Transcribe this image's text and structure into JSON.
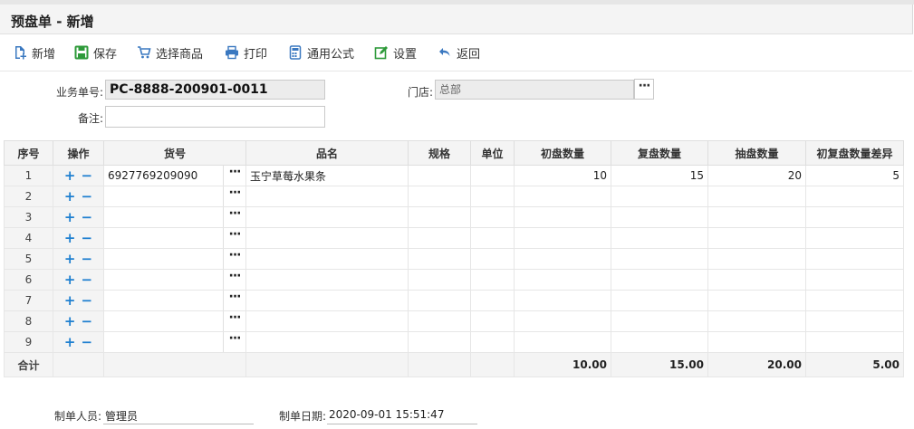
{
  "page": {
    "title": "预盘单 - 新增"
  },
  "toolbar": {
    "add_label": "新增",
    "save_label": "保存",
    "select_goods_label": "选择商品",
    "print_label": "打印",
    "formula_label": "通用公式",
    "settings_label": "设置",
    "back_label": "返回"
  },
  "form": {
    "biz_no_label": "业务单号:",
    "biz_no_value": "PC-8888-200901-0011",
    "store_label": "门店:",
    "store_value": "总部",
    "remark_label": "备注:",
    "remark_value": ""
  },
  "grid": {
    "headers": {
      "seq": "序号",
      "ops": "操作",
      "code": "货号",
      "name": "品名",
      "spec": "规格",
      "unit": "单位",
      "first_qty": "初盘数量",
      "recheck_qty": "复盘数量",
      "sample_qty": "抽盘数量",
      "diff_qty": "初复盘数量差异"
    },
    "rows": [
      {
        "seq": "1",
        "code": "6927769209090",
        "name": "玉宁草莓水果条",
        "spec": "",
        "unit": "",
        "first_qty": "10",
        "recheck_qty": "15",
        "sample_qty": "20",
        "diff_qty": "5"
      },
      {
        "seq": "2",
        "code": "",
        "name": "",
        "spec": "",
        "unit": "",
        "first_qty": "",
        "recheck_qty": "",
        "sample_qty": "",
        "diff_qty": ""
      },
      {
        "seq": "3",
        "code": "",
        "name": "",
        "spec": "",
        "unit": "",
        "first_qty": "",
        "recheck_qty": "",
        "sample_qty": "",
        "diff_qty": ""
      },
      {
        "seq": "4",
        "code": "",
        "name": "",
        "spec": "",
        "unit": "",
        "first_qty": "",
        "recheck_qty": "",
        "sample_qty": "",
        "diff_qty": ""
      },
      {
        "seq": "5",
        "code": "",
        "name": "",
        "spec": "",
        "unit": "",
        "first_qty": "",
        "recheck_qty": "",
        "sample_qty": "",
        "diff_qty": ""
      },
      {
        "seq": "6",
        "code": "",
        "name": "",
        "spec": "",
        "unit": "",
        "first_qty": "",
        "recheck_qty": "",
        "sample_qty": "",
        "diff_qty": ""
      },
      {
        "seq": "7",
        "code": "",
        "name": "",
        "spec": "",
        "unit": "",
        "first_qty": "",
        "recheck_qty": "",
        "sample_qty": "",
        "diff_qty": ""
      },
      {
        "seq": "8",
        "code": "",
        "name": "",
        "spec": "",
        "unit": "",
        "first_qty": "",
        "recheck_qty": "",
        "sample_qty": "",
        "diff_qty": ""
      },
      {
        "seq": "9",
        "code": "",
        "name": "",
        "spec": "",
        "unit": "",
        "first_qty": "",
        "recheck_qty": "",
        "sample_qty": "",
        "diff_qty": ""
      }
    ],
    "total": {
      "label": "合计",
      "first_qty": "10.00",
      "recheck_qty": "15.00",
      "sample_qty": "20.00",
      "diff_qty": "5.00"
    },
    "plus_symbol": "+",
    "minus_symbol": "−",
    "dots_symbol": "···"
  },
  "footer": {
    "creator_label": "制单人员:",
    "creator_value": "管理员",
    "date_label": "制单日期:",
    "date_value": "2020-09-01 15:51:47"
  },
  "icons": {
    "add": "add-doc-icon",
    "save": "save-floppy-icon",
    "select_goods": "cart-icon",
    "print": "printer-icon",
    "formula": "calculator-icon",
    "settings": "edit-settings-icon",
    "back": "back-arrow-icon"
  },
  "colors": {
    "accent": "#1e7fd0",
    "header_bg": "#f4f4f4",
    "readonly_bg": "#ececec"
  }
}
